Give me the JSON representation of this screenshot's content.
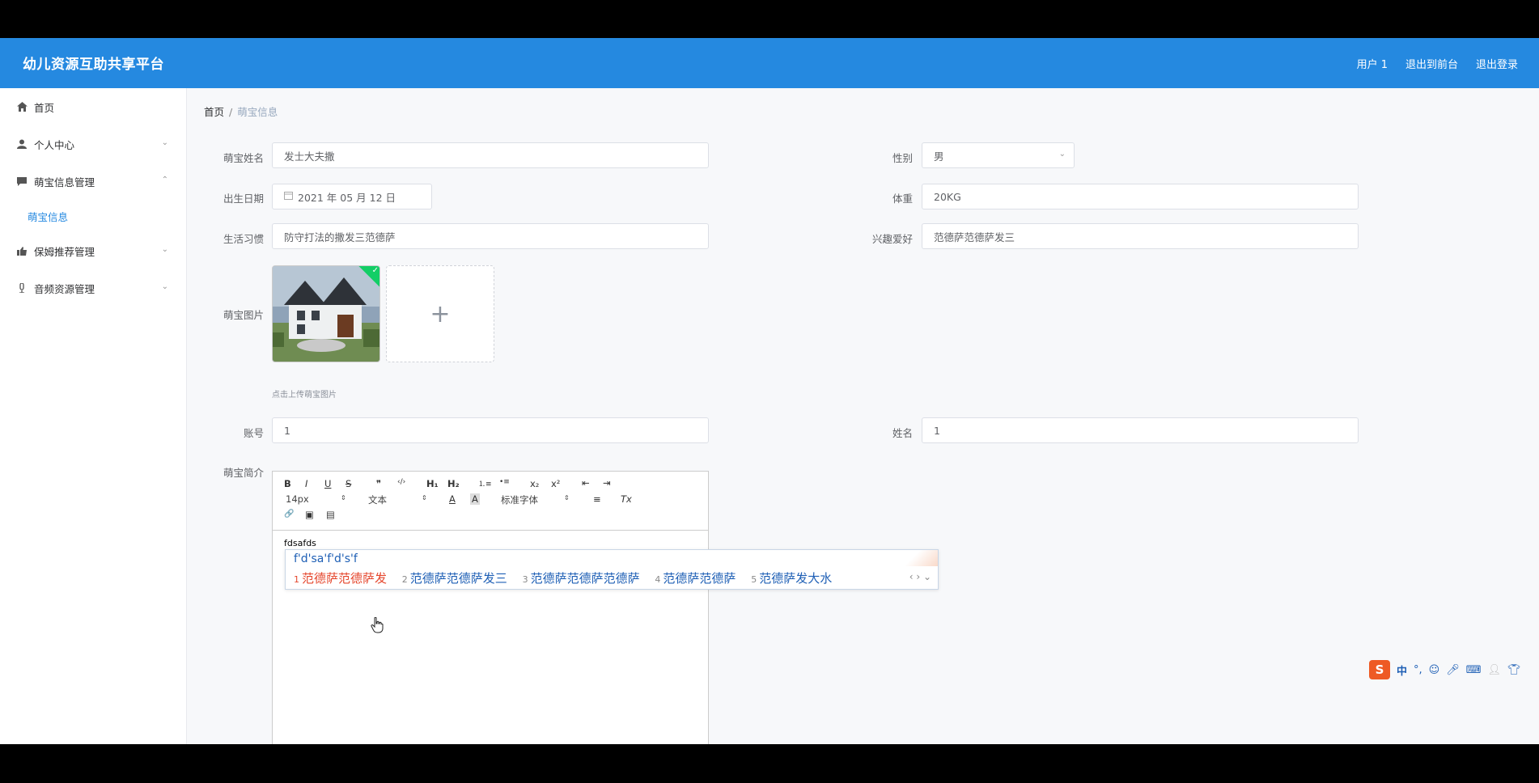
{
  "header": {
    "title": "幼儿资源互助共享平台",
    "user": "用户 1",
    "to_frontend": "退出到前台",
    "logout": "退出登录"
  },
  "sidebar": {
    "home": "首页",
    "personal": "个人中心",
    "baby_info_mgmt": "萌宝信息管理",
    "baby_info": "萌宝信息",
    "nanny_mgmt": "保姆推荐管理",
    "audio_mgmt": "音频资源管理"
  },
  "breadcrumb": {
    "home": "首页",
    "sep": "/",
    "current": "萌宝信息"
  },
  "form": {
    "name_label": "萌宝姓名",
    "name_value": "发士大夫撒",
    "gender_label": "性别",
    "gender_value": "男",
    "birth_label": "出生日期",
    "birth_value": "2021 年 05 月 12 日",
    "weight_label": "体重",
    "weight_value": "20KG",
    "habit_label": "生活习惯",
    "habit_value": "防守打法的撒发三范德萨",
    "hobby_label": "兴趣爱好",
    "hobby_value": "范德萨范德萨发三",
    "photo_label": "萌宝图片",
    "photo_add": "+",
    "photo_hint": "点击上传萌宝图片",
    "account_label": "账号",
    "account_value": "1",
    "realname_label": "姓名",
    "realname_value": "1",
    "intro_label": "萌宝简介"
  },
  "editor": {
    "bold": "B",
    "italic": "I",
    "underline": "U",
    "strike": "S",
    "quote": "❞",
    "code": "‹/›",
    "h1": "H₁",
    "h2": "H₂",
    "ol": "⒈≡",
    "ul": "•≡",
    "sub": "x₂",
    "sup": "x²",
    "outdent": "⇤",
    "indent": "⇥",
    "size": "14px",
    "text_type": "文本",
    "font_color": "A",
    "bg_color": "A",
    "font_family": "标准字体",
    "align": "≡",
    "clear": "Tx",
    "link": "🔗",
    "image": "▣",
    "video": "▤",
    "content": "fdsafds"
  },
  "ime": {
    "composition": "f'd'sa'f'd's'f",
    "candidates": [
      {
        "num": "1",
        "text": "范德萨范德萨发"
      },
      {
        "num": "2",
        "text": "范德萨范德萨发三"
      },
      {
        "num": "3",
        "text": "范德萨范德萨范德萨"
      },
      {
        "num": "4",
        "text": "范德萨范德萨"
      },
      {
        "num": "5",
        "text": "范德萨发大水"
      }
    ],
    "nav": "‹ › ⌄",
    "bar_mode": "中",
    "bar_punct": "°,",
    "bar_logo": "S"
  }
}
